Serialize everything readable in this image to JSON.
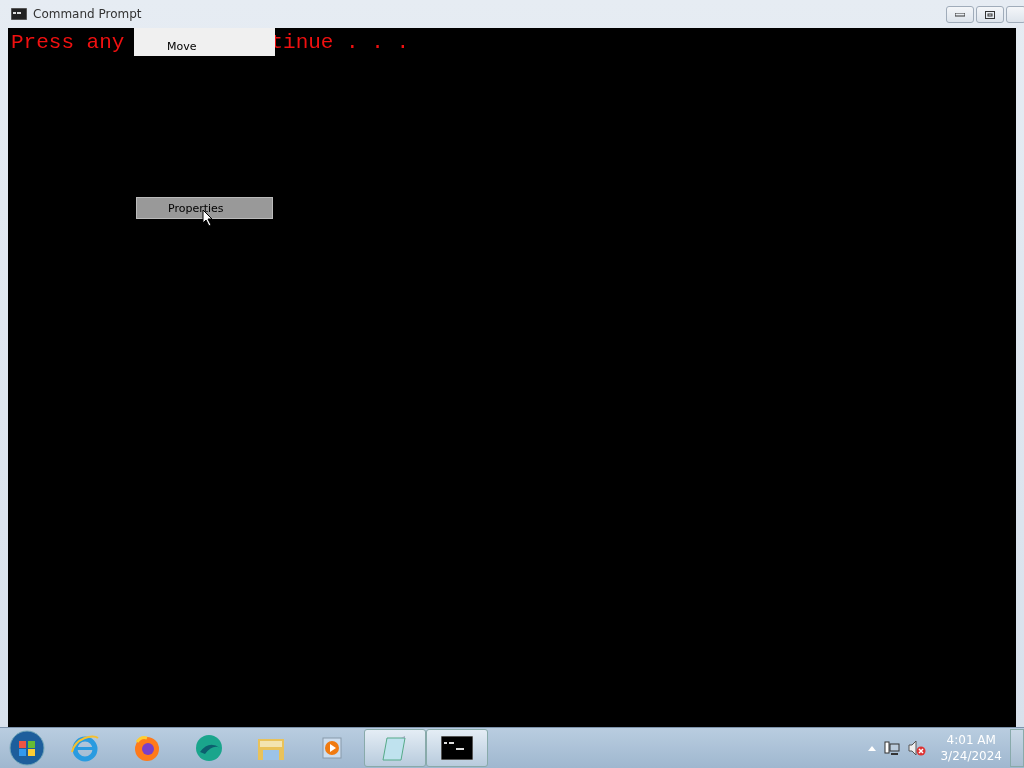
{
  "window": {
    "title": "Command Prompt"
  },
  "console": {
    "lines": [
      {
        "text": "Press any"
      },
      {
        "text": "tinue . . ."
      }
    ]
  },
  "context_menu": {
    "items": [
      {
        "label": "Move",
        "selected": false
      },
      {
        "label": "Properties",
        "selected": true
      }
    ]
  },
  "taskbar": {
    "items": [
      {
        "kind": "start",
        "open": false
      },
      {
        "kind": "browser-e",
        "open": false
      },
      {
        "kind": "fox",
        "open": false
      },
      {
        "kind": "wave",
        "open": false
      },
      {
        "kind": "folder",
        "open": false
      },
      {
        "kind": "media",
        "open": false
      },
      {
        "kind": "notepad",
        "open": true
      },
      {
        "kind": "terminal",
        "open": true
      }
    ],
    "clock": {
      "time": "4:01 AM",
      "date": "3/24/2024"
    }
  }
}
